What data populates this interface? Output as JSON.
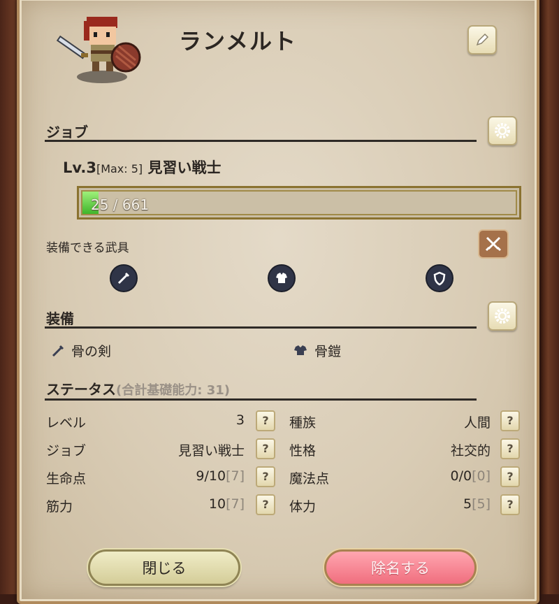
{
  "character": {
    "name": "ランメルト"
  },
  "job": {
    "section_title": "ジョブ",
    "level_prefix": "Lv.3",
    "max_text": "[Max: 5]",
    "job_name": "見習い戦士",
    "xp_text": "25 / 661",
    "xp_current": 25,
    "xp_max": 661
  },
  "equippable": {
    "title": "装備できる武具",
    "icons": [
      "sword-icon",
      "armor-icon",
      "shield-icon"
    ]
  },
  "equipment": {
    "section_title": "装備",
    "items": [
      {
        "icon": "sword-icon",
        "name": "骨の剣"
      },
      {
        "icon": "armor-icon",
        "name": "骨鎧"
      }
    ]
  },
  "status": {
    "title": "ステータス",
    "subtitle": "(合計基礎能力: 31)",
    "left": [
      {
        "label": "レベル",
        "value": "3",
        "bracket": ""
      },
      {
        "label": "ジョブ",
        "value": "見習い戦士",
        "bracket": ""
      },
      {
        "label": "生命点",
        "value": "9/10",
        "bracket": "[7]"
      },
      {
        "label": "筋力",
        "value": "10",
        "bracket": "[7]"
      }
    ],
    "right": [
      {
        "label": "種族",
        "value": "人間",
        "bracket": ""
      },
      {
        "label": "性格",
        "value": "社交的",
        "bracket": ""
      },
      {
        "label": "魔法点",
        "value": "0/0",
        "bracket": "[0]"
      },
      {
        "label": "体力",
        "value": "5",
        "bracket": "[5]"
      }
    ],
    "help_glyph": "?"
  },
  "buttons": {
    "close": "閉じる",
    "dismiss": "除名する"
  },
  "colors": {
    "xp_fill": "#3fb52a",
    "dismiss": "#f06e7e",
    "close": "#d4cd98"
  }
}
